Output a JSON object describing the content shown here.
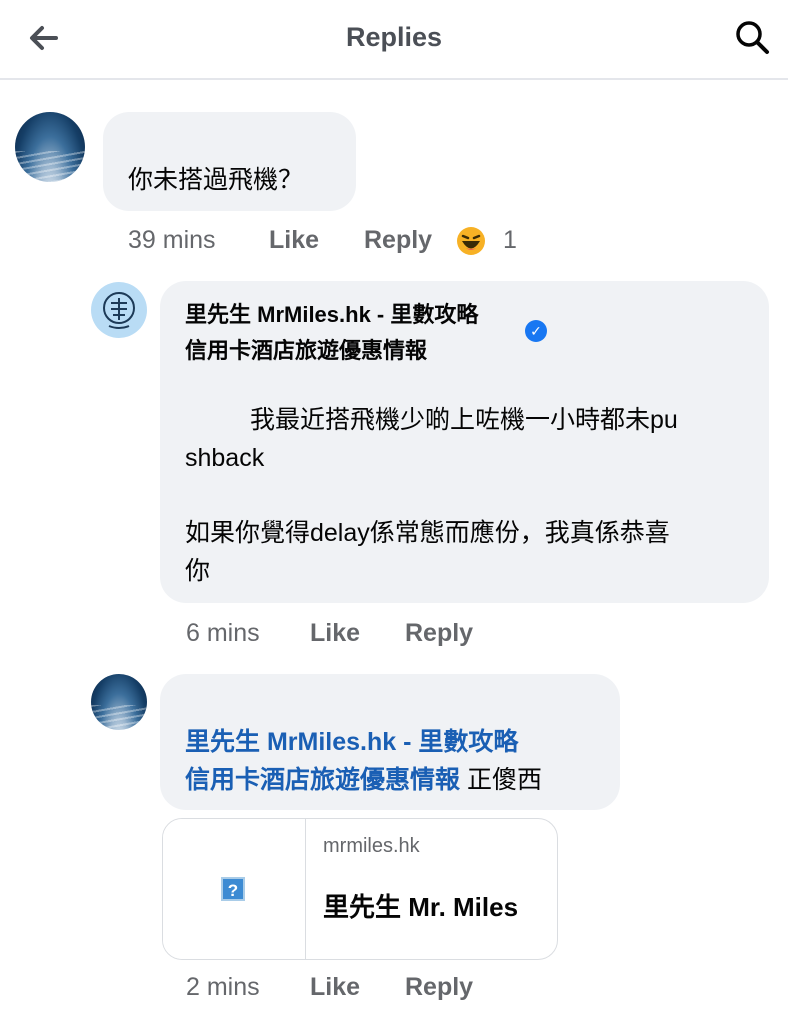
{
  "header": {
    "title": "Replies",
    "back_icon": "arrow-left-icon",
    "search_icon": "search-icon"
  },
  "comments": [
    {
      "avatar": "ocean-photo-avatar",
      "text": "你未搭過飛機？",
      "time": "39 mins",
      "like_label": "Like",
      "reply_label": "Reply",
      "reaction_icon": "haha-reaction-icon",
      "reaction_count": "1"
    },
    {
      "avatar": "mrmiles-logo-avatar",
      "author_line1": "里先生 MrMiles.hk - 里數攻略",
      "author_line2": "信用卡酒店旅遊優惠情報",
      "verified_icon": "verified-badge-icon",
      "text_line1": "我最近搭飛機少啲上咗機一小時都未pu",
      "text_line2": "shback",
      "text_line3": "如果你覺得delay係常態而應份，我真係恭喜",
      "text_line4": "你",
      "time": "6 mins",
      "like_label": "Like",
      "reply_label": "Reply"
    },
    {
      "avatar": "ocean-photo-avatar",
      "mention_line1": "里先生 MrMiles.hk - 里數攻略",
      "mention_line2": "信用卡酒店旅遊優惠情報",
      "text_after_mention": " 正傻西",
      "link_preview": {
        "domain": "mrmiles.hk",
        "title": "里先生 Mr. Miles",
        "thumbnail_icon": "broken-image-icon",
        "thumbnail_glyph": "?"
      },
      "time": "2 mins",
      "like_label": "Like",
      "reply_label": "Reply"
    }
  ],
  "colors": {
    "bubble": "#f0f2f5",
    "meta_text": "#65676b",
    "mention": "#1a5fb4",
    "verified": "#1877f2"
  }
}
